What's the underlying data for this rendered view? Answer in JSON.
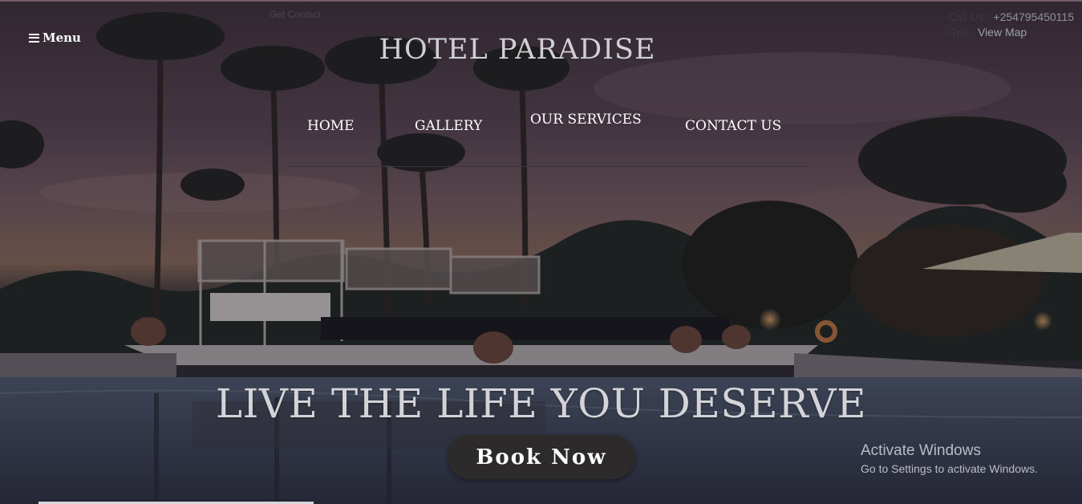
{
  "header": {
    "menu_label": "Menu",
    "site_title": "HOTEL PARADISE",
    "ghost_text": "Get Contact"
  },
  "contact": {
    "call_label": "Call Us :",
    "phone": "+254795450115",
    "gps_label": "Gps :",
    "map_link": "View Map"
  },
  "nav": {
    "items": [
      {
        "label": "HOME"
      },
      {
        "label": "GALLERY"
      },
      {
        "label": "OUR SERVICES"
      },
      {
        "label": "CONTACT US"
      }
    ]
  },
  "hero": {
    "tagline": "LIVE THE LIFE YOU DESERVE",
    "cta_label": "Book Now",
    "scene": "resort-pool-dusk"
  },
  "watermark": {
    "title": "Activate Windows",
    "subtitle": "Go to Settings to activate Windows."
  },
  "colors": {
    "overlay": "#2a2630",
    "button_bg": "#2d2a2b",
    "title_text": "#cfcfd4",
    "nav_text": "#ffffff"
  }
}
